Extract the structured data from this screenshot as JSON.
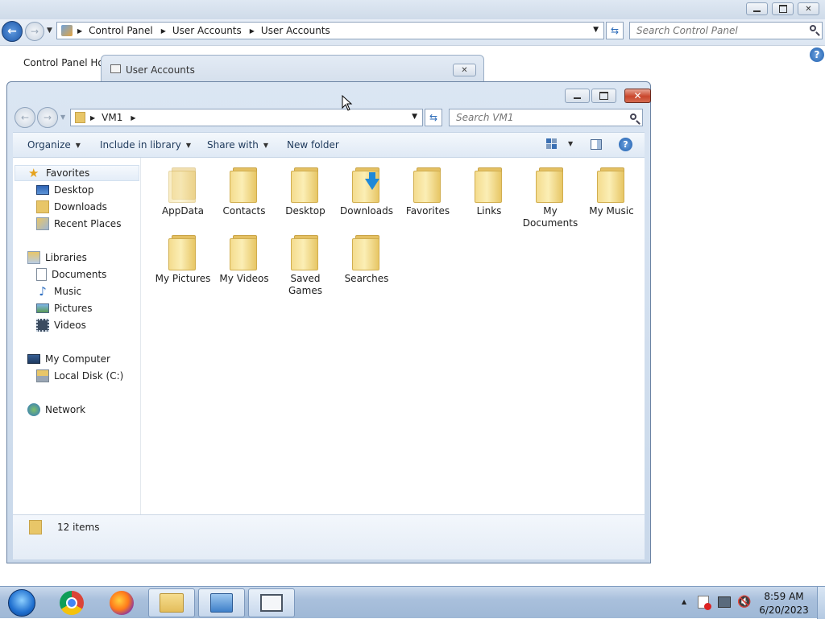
{
  "control_panel": {
    "breadcrumb": [
      "Control Panel",
      "User Accounts",
      "User Accounts"
    ],
    "search_placeholder": "Search Control Panel",
    "left_link": "Control Panel Hor",
    "help_glyph": "?"
  },
  "user_accounts_dialog": {
    "title": "User Accounts"
  },
  "explorer": {
    "breadcrumb": [
      "VM1"
    ],
    "search_placeholder": "Search VM1",
    "toolbar": {
      "organize": "Organize",
      "include_in_library": "Include in library",
      "share_with": "Share with",
      "new_folder": "New folder"
    },
    "nav": {
      "favorites": {
        "label": "Favorites",
        "items": [
          "Desktop",
          "Downloads",
          "Recent Places"
        ]
      },
      "libraries": {
        "label": "Libraries",
        "items": [
          "Documents",
          "Music",
          "Pictures",
          "Videos"
        ]
      },
      "computer": {
        "label": "My Computer",
        "items": [
          "Local Disk (C:)"
        ]
      },
      "network": {
        "label": "Network"
      }
    },
    "folders": [
      {
        "name": "AppData",
        "icon": "folder-faded-icon"
      },
      {
        "name": "Contacts",
        "icon": "folder-icon"
      },
      {
        "name": "Desktop",
        "icon": "folder-icon"
      },
      {
        "name": "Downloads",
        "icon": "downloads-folder-icon"
      },
      {
        "name": "Favorites",
        "icon": "folder-icon"
      },
      {
        "name": "Links",
        "icon": "folder-icon"
      },
      {
        "name": "My Documents",
        "icon": "folder-icon"
      },
      {
        "name": "My Music",
        "icon": "folder-icon"
      },
      {
        "name": "My Pictures",
        "icon": "folder-icon"
      },
      {
        "name": "My Videos",
        "icon": "folder-icon"
      },
      {
        "name": "Saved Games",
        "icon": "folder-icon"
      },
      {
        "name": "Searches",
        "icon": "folder-icon"
      }
    ],
    "status": "12 items"
  },
  "taskbar": {
    "pinned": [
      "start-orb-icon",
      "chrome-icon",
      "firefox-icon",
      "file-explorer-icon",
      "control-panel-icon",
      "user-accounts-window-icon"
    ],
    "clock": {
      "time": "8:59 AM",
      "date": "6/20/2023"
    }
  },
  "colors": {
    "accent": "#1e395b",
    "close_red": "#c9462c",
    "folder_yellow": "#f4dc8e",
    "taskbar": "#a9c0dc"
  }
}
